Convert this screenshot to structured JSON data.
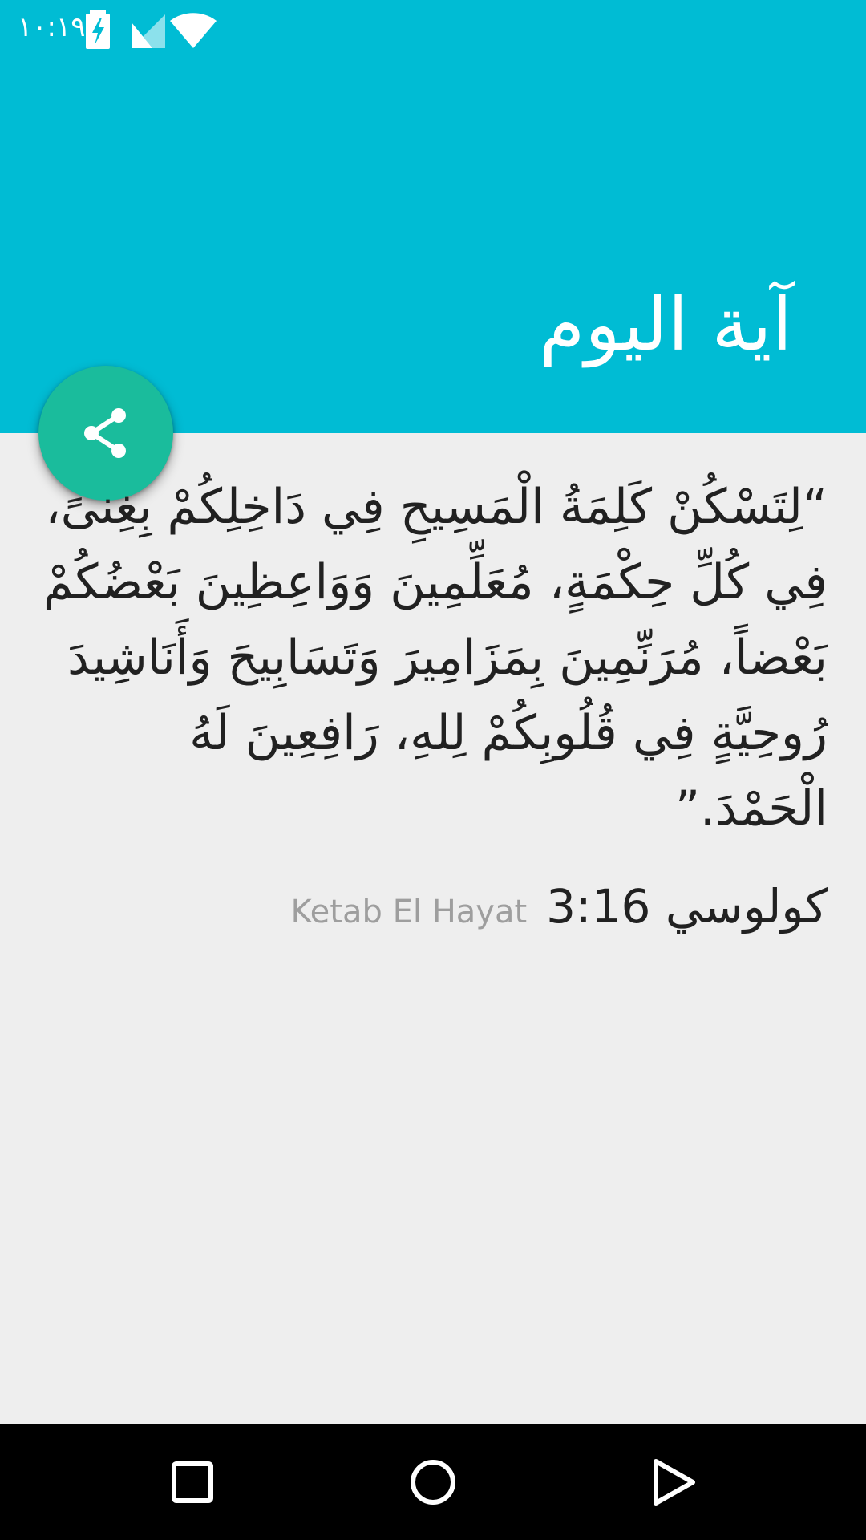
{
  "status_bar": {
    "time": "١٠:١٩",
    "icons": [
      "battery-charging-icon",
      "cellular-signal-icon",
      "wifi-icon"
    ]
  },
  "app_bar": {
    "title": "آية اليوم",
    "color": "#00bcd4"
  },
  "fab": {
    "icon": "share-icon",
    "color": "#1abc9c"
  },
  "verse": {
    "text": "“لِتَسْكُنْ كَلِمَةُ الْمَسِيحِ فِي دَاخِلِكُمْ بِغِنىً، فِي كُلِّ حِكْمَةٍ، مُعَلِّمِينَ وَوَاعِظِينَ بَعْضُكُمْ بَعْضاً، مُرَنِّمِينَ بِمَزَامِيرَ وَتَسَابِيحَ وَأَنَاشِيدَ رُوحِيَّةٍ فِي قُلُوبِكُمْ لِلهِ، رَافِعِينَ لَهُ الْحَمْدَ.”",
    "reference": "كولوسي 3:16",
    "source": "Ketab El Hayat"
  },
  "nav_bar": {
    "icons": [
      "recents-icon",
      "home-icon",
      "back-icon"
    ]
  }
}
